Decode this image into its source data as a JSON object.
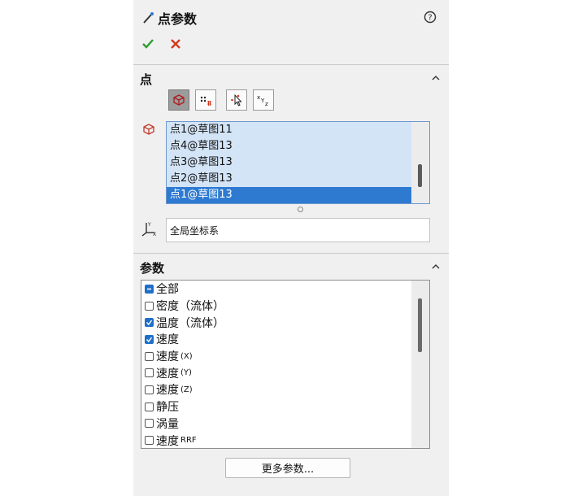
{
  "header": {
    "title": "点参数",
    "help_icon": "help-icon",
    "ok_icon": "checkmark-icon",
    "cancel_icon": "close-icon"
  },
  "points_section": {
    "title": "点",
    "toolbar": [
      "3d-box-icon",
      "points-grid-icon",
      "cursor-select-icon",
      "xyz-coordinates-icon"
    ],
    "items": [
      "点1@草图11",
      "点4@草图13",
      "点3@草图13",
      "点2@草图13",
      "点1@草图13"
    ],
    "selected_index": 4
  },
  "coordinate_system": {
    "value": "全局坐标系"
  },
  "params_section": {
    "title": "参数",
    "items": [
      {
        "label": "全部",
        "state": "partial"
      },
      {
        "label": "密度（流体）",
        "state": "unchecked"
      },
      {
        "label": "温度（流体）",
        "state": "checked"
      },
      {
        "label": "速度",
        "state": "checked"
      },
      {
        "label": "速度",
        "suffix": "(X)",
        "state": "unchecked"
      },
      {
        "label": "速度",
        "suffix": "(Y)",
        "state": "unchecked"
      },
      {
        "label": "速度",
        "suffix": "(Z)",
        "state": "unchecked"
      },
      {
        "label": "静压",
        "state": "unchecked"
      },
      {
        "label": "涡量",
        "state": "unchecked"
      },
      {
        "label": "速度",
        "suffix": "RRF",
        "state": "unchecked"
      }
    ]
  },
  "more_button": {
    "label": "更多参数..."
  },
  "colors": {
    "selection": "#2e7ad1",
    "list_bg": "#d3e4f7",
    "check": "#1f6fc9",
    "ok": "#2e9d2e",
    "cancel": "#d33a1e"
  }
}
